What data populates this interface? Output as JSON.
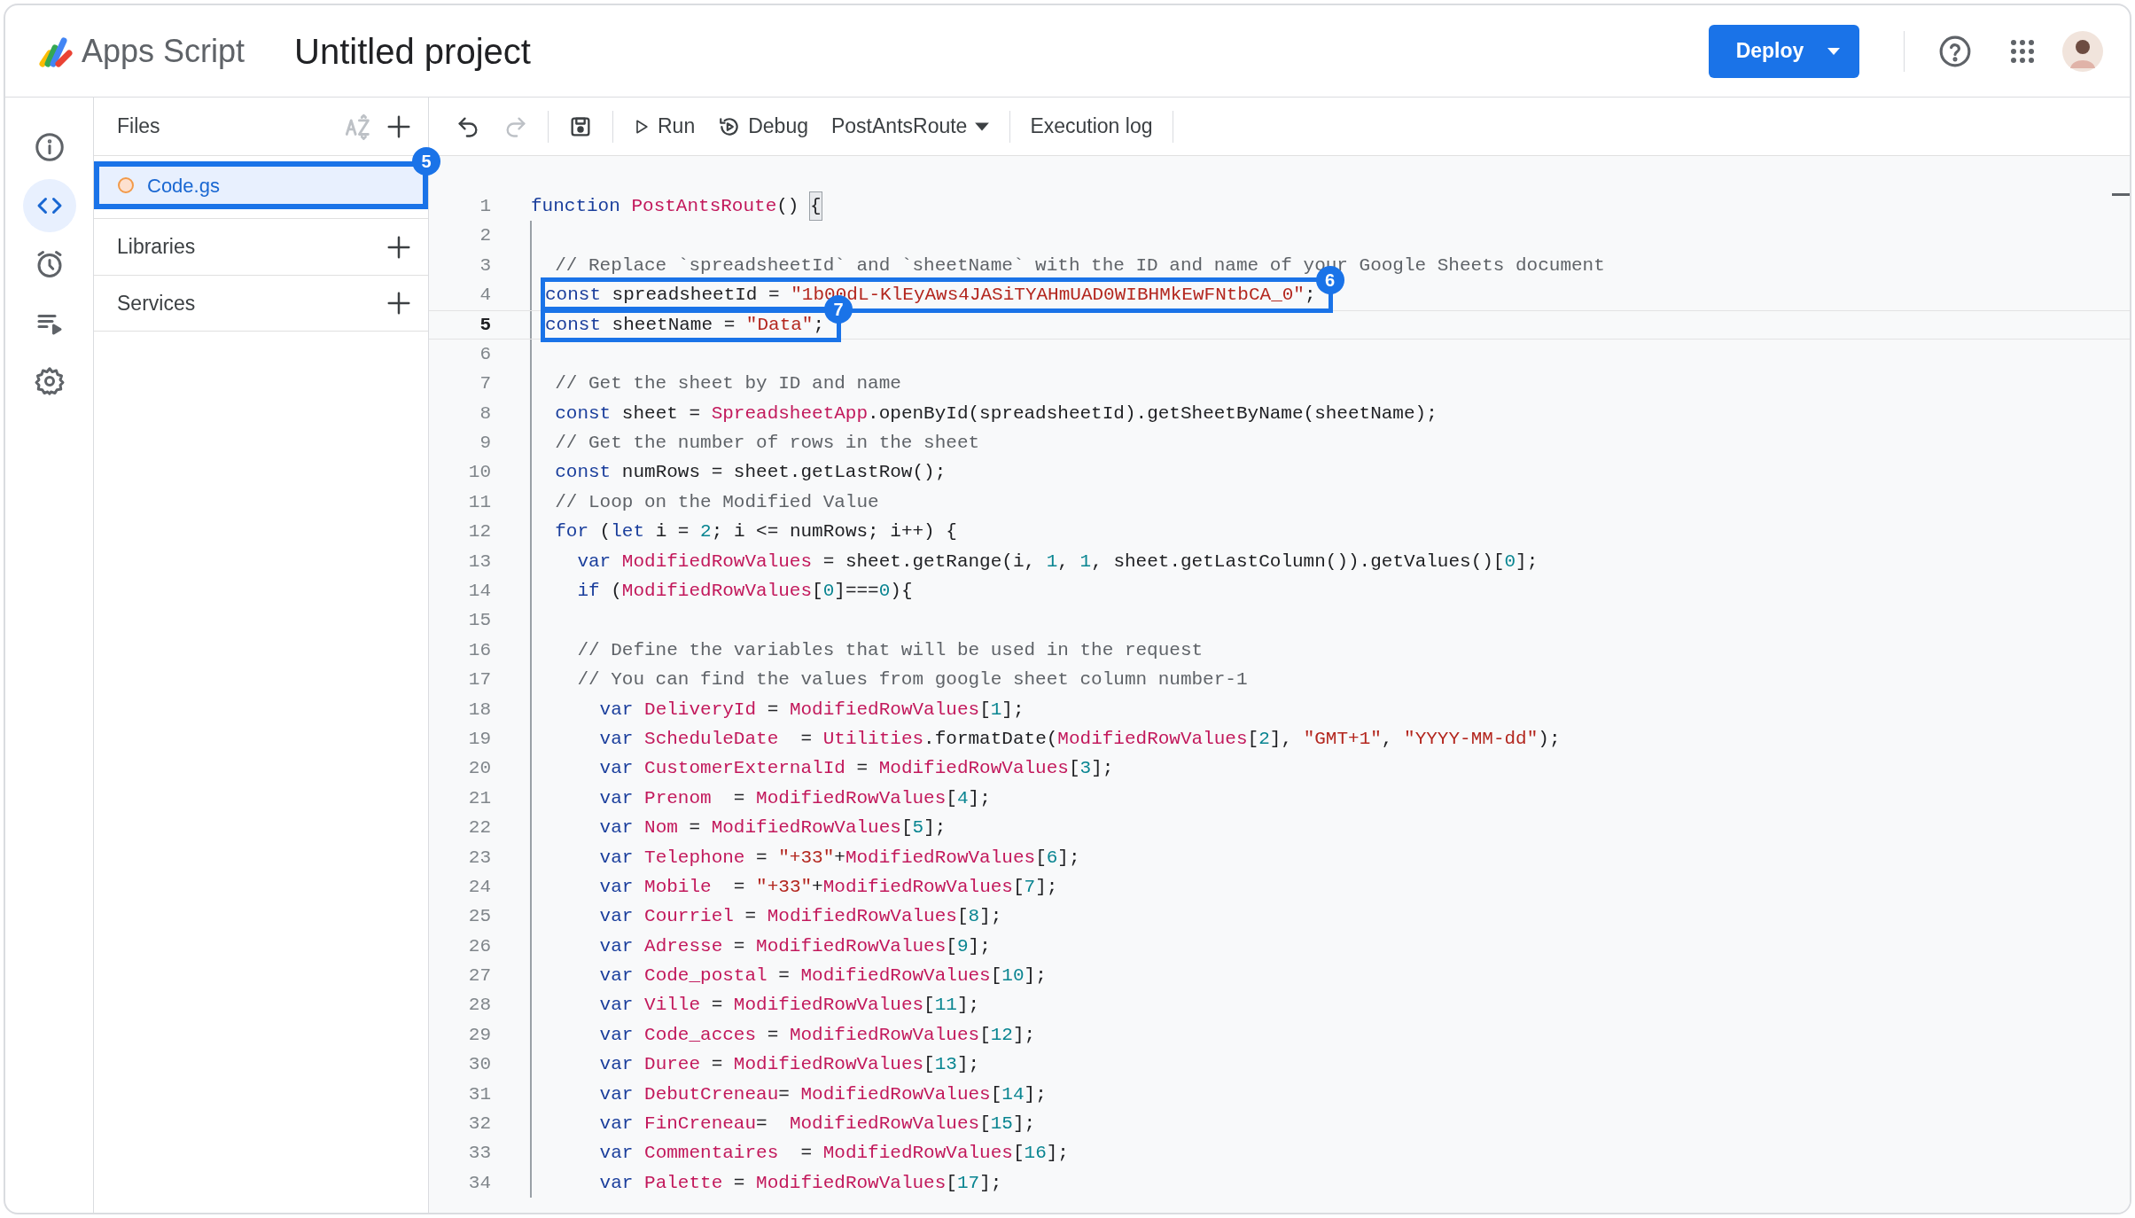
{
  "app": {
    "name": "Apps Script",
    "project_title": "Untitled project",
    "deploy_button": "Deploy"
  },
  "rail": [
    {
      "selected": false
    },
    {
      "selected": true
    },
    {
      "selected": false
    },
    {
      "selected": false
    },
    {
      "selected": false
    }
  ],
  "files_panel": {
    "title": "Files",
    "files": [
      {
        "name": "Code.gs",
        "selected": true,
        "callout": "5"
      }
    ],
    "sections": [
      {
        "title": "Libraries"
      },
      {
        "title": "Services"
      }
    ]
  },
  "toolbar": {
    "undo": {
      "disabled": false
    },
    "redo": {
      "disabled": true
    },
    "run": "Run",
    "debug": "Debug",
    "function_select": "PostAntsRoute",
    "execution_log": "Execution log"
  },
  "editor": {
    "lines": [
      {
        "number": "1",
        "current": false,
        "tokens": [
          {
            "kind": "keyword",
            "text": "function "
          },
          {
            "kind": "name",
            "text": "PostAntsRoute"
          },
          {
            "kind": "plain",
            "text": "() "
          },
          {
            "kind": "bracket",
            "text": "{"
          }
        ]
      },
      {
        "number": "2",
        "current": false
      },
      {
        "number": "3",
        "current": false,
        "tokens": [
          {
            "kind": "comment",
            "text": "  // Replace `spreadsheetId` and `sheetName` with the ID and name of your Google Sheets document"
          }
        ]
      },
      {
        "number": "4",
        "current": false,
        "callout": "6",
        "tokens": [
          {
            "kind": "keyword",
            "text": "const"
          },
          {
            "kind": "plain",
            "text": " spreadsheetId = "
          },
          {
            "kind": "string",
            "text": "\"1b00dL-KlEyAws4JASiTYAHmUAD0WIBHMkEwFNtbCA_0\""
          },
          {
            "kind": "plain",
            "text": ";"
          }
        ]
      },
      {
        "number": "5",
        "current": true,
        "callout": "7",
        "tokens": [
          {
            "kind": "keyword",
            "text": "const"
          },
          {
            "kind": "plain",
            "text": " sheetName = "
          },
          {
            "kind": "string",
            "text": "\"Data\""
          },
          {
            "kind": "plain",
            "text": ";"
          }
        ]
      },
      {
        "number": "6",
        "current": false
      },
      {
        "number": "7",
        "current": false,
        "tokens": [
          {
            "kind": "comment",
            "text": "  // Get the sheet by ID and name"
          }
        ]
      },
      {
        "number": "8",
        "current": false,
        "tokens": [
          {
            "kind": "keyword",
            "text": "  const"
          },
          {
            "kind": "plain",
            "text": " sheet = "
          },
          {
            "kind": "name",
            "text": "SpreadsheetApp"
          },
          {
            "kind": "plain",
            "text": ".openById(spreadsheetId).getSheetByName(sheetName);"
          }
        ]
      },
      {
        "number": "9",
        "current": false,
        "tokens": [
          {
            "kind": "comment",
            "text": "  // Get the number of rows in the sheet"
          }
        ]
      },
      {
        "number": "10",
        "current": false,
        "tokens": [
          {
            "kind": "keyword",
            "text": "  const"
          },
          {
            "kind": "plain",
            "text": " numRows = sheet.getLastRow();"
          }
        ]
      },
      {
        "number": "11",
        "current": false,
        "tokens": [
          {
            "kind": "comment",
            "text": "  // Loop on the Modified Value"
          }
        ]
      },
      {
        "number": "12",
        "current": false,
        "tokens": [
          {
            "kind": "keyword",
            "text": "  for"
          },
          {
            "kind": "plain",
            "text": " ("
          },
          {
            "kind": "keyword",
            "text": "let"
          },
          {
            "kind": "plain",
            "text": " i = "
          },
          {
            "kind": "number",
            "text": "2"
          },
          {
            "kind": "plain",
            "text": "; i <= numRows; i++) {"
          }
        ]
      },
      {
        "number": "13",
        "current": false,
        "tokens": [
          {
            "kind": "keyword",
            "text": "    var "
          },
          {
            "kind": "name",
            "text": "ModifiedRowValues"
          },
          {
            "kind": "plain",
            "text": " = sheet.getRange(i, "
          },
          {
            "kind": "number",
            "text": "1"
          },
          {
            "kind": "plain",
            "text": ", "
          },
          {
            "kind": "number",
            "text": "1"
          },
          {
            "kind": "plain",
            "text": ", sheet.getLastColumn()).getValues()["
          },
          {
            "kind": "number",
            "text": "0"
          },
          {
            "kind": "plain",
            "text": "];"
          }
        ]
      },
      {
        "number": "14",
        "current": false,
        "tokens": [
          {
            "kind": "keyword",
            "text": "    if"
          },
          {
            "kind": "plain",
            "text": " ("
          },
          {
            "kind": "name",
            "text": "ModifiedRowValues"
          },
          {
            "kind": "plain",
            "text": "["
          },
          {
            "kind": "number",
            "text": "0"
          },
          {
            "kind": "plain",
            "text": "]==="
          },
          {
            "kind": "number",
            "text": "0"
          },
          {
            "kind": "plain",
            "text": "){"
          }
        ]
      },
      {
        "number": "15",
        "current": false
      },
      {
        "number": "16",
        "current": false,
        "tokens": [
          {
            "kind": "comment",
            "text": "    // Define the variables that will be used in the request"
          }
        ]
      },
      {
        "number": "17",
        "current": false,
        "tokens": [
          {
            "kind": "comment",
            "text": "    // You can find the values from google sheet column number-1"
          }
        ]
      },
      {
        "number": "18",
        "current": false,
        "tokens": [
          {
            "kind": "keyword",
            "text": "      var "
          },
          {
            "kind": "name",
            "text": "DeliveryId"
          },
          {
            "kind": "plain",
            "text": " = "
          },
          {
            "kind": "name",
            "text": "ModifiedRowValues"
          },
          {
            "kind": "plain",
            "text": "["
          },
          {
            "kind": "number",
            "text": "1"
          },
          {
            "kind": "plain",
            "text": "];"
          }
        ]
      },
      {
        "number": "19",
        "current": false,
        "tokens": [
          {
            "kind": "keyword",
            "text": "      var "
          },
          {
            "kind": "name",
            "text": "ScheduleDate"
          },
          {
            "kind": "plain",
            "text": "  = "
          },
          {
            "kind": "name",
            "text": "Utilities"
          },
          {
            "kind": "plain",
            "text": ".formatDate("
          },
          {
            "kind": "name",
            "text": "ModifiedRowValues"
          },
          {
            "kind": "plain",
            "text": "["
          },
          {
            "kind": "number",
            "text": "2"
          },
          {
            "kind": "plain",
            "text": "], "
          },
          {
            "kind": "string",
            "text": "\"GMT+1\""
          },
          {
            "kind": "plain",
            "text": ", "
          },
          {
            "kind": "string",
            "text": "\"YYYY-MM-dd\""
          },
          {
            "kind": "plain",
            "text": ");"
          }
        ]
      },
      {
        "number": "20",
        "current": false,
        "tokens": [
          {
            "kind": "keyword",
            "text": "      var "
          },
          {
            "kind": "name",
            "text": "CustomerExternalId"
          },
          {
            "kind": "plain",
            "text": " = "
          },
          {
            "kind": "name",
            "text": "ModifiedRowValues"
          },
          {
            "kind": "plain",
            "text": "["
          },
          {
            "kind": "number",
            "text": "3"
          },
          {
            "kind": "plain",
            "text": "];"
          }
        ]
      },
      {
        "number": "21",
        "current": false,
        "tokens": [
          {
            "kind": "keyword",
            "text": "      var "
          },
          {
            "kind": "name",
            "text": "Prenom"
          },
          {
            "kind": "plain",
            "text": "  = "
          },
          {
            "kind": "name",
            "text": "ModifiedRowValues"
          },
          {
            "kind": "plain",
            "text": "["
          },
          {
            "kind": "number",
            "text": "4"
          },
          {
            "kind": "plain",
            "text": "];"
          }
        ]
      },
      {
        "number": "22",
        "current": false,
        "tokens": [
          {
            "kind": "keyword",
            "text": "      var "
          },
          {
            "kind": "name",
            "text": "Nom"
          },
          {
            "kind": "plain",
            "text": " = "
          },
          {
            "kind": "name",
            "text": "ModifiedRowValues"
          },
          {
            "kind": "plain",
            "text": "["
          },
          {
            "kind": "number",
            "text": "5"
          },
          {
            "kind": "plain",
            "text": "];"
          }
        ]
      },
      {
        "number": "23",
        "current": false,
        "tokens": [
          {
            "kind": "keyword",
            "text": "      var "
          },
          {
            "kind": "name",
            "text": "Telephone"
          },
          {
            "kind": "plain",
            "text": " = "
          },
          {
            "kind": "string",
            "text": "\"+33\""
          },
          {
            "kind": "plain",
            "text": "+"
          },
          {
            "kind": "name",
            "text": "ModifiedRowValues"
          },
          {
            "kind": "plain",
            "text": "["
          },
          {
            "kind": "number",
            "text": "6"
          },
          {
            "kind": "plain",
            "text": "];"
          }
        ]
      },
      {
        "number": "24",
        "current": false,
        "tokens": [
          {
            "kind": "keyword",
            "text": "      var "
          },
          {
            "kind": "name",
            "text": "Mobile"
          },
          {
            "kind": "plain",
            "text": "  = "
          },
          {
            "kind": "string",
            "text": "\"+33\""
          },
          {
            "kind": "plain",
            "text": "+"
          },
          {
            "kind": "name",
            "text": "ModifiedRowValues"
          },
          {
            "kind": "plain",
            "text": "["
          },
          {
            "kind": "number",
            "text": "7"
          },
          {
            "kind": "plain",
            "text": "];"
          }
        ]
      },
      {
        "number": "25",
        "current": false,
        "tokens": [
          {
            "kind": "keyword",
            "text": "      var "
          },
          {
            "kind": "name",
            "text": "Courriel"
          },
          {
            "kind": "plain",
            "text": " = "
          },
          {
            "kind": "name",
            "text": "ModifiedRowValues"
          },
          {
            "kind": "plain",
            "text": "["
          },
          {
            "kind": "number",
            "text": "8"
          },
          {
            "kind": "plain",
            "text": "];"
          }
        ]
      },
      {
        "number": "26",
        "current": false,
        "tokens": [
          {
            "kind": "keyword",
            "text": "      var "
          },
          {
            "kind": "name",
            "text": "Adresse"
          },
          {
            "kind": "plain",
            "text": " = "
          },
          {
            "kind": "name",
            "text": "ModifiedRowValues"
          },
          {
            "kind": "plain",
            "text": "["
          },
          {
            "kind": "number",
            "text": "9"
          },
          {
            "kind": "plain",
            "text": "];"
          }
        ]
      },
      {
        "number": "27",
        "current": false,
        "tokens": [
          {
            "kind": "keyword",
            "text": "      var "
          },
          {
            "kind": "name",
            "text": "Code_postal"
          },
          {
            "kind": "plain",
            "text": " = "
          },
          {
            "kind": "name",
            "text": "ModifiedRowValues"
          },
          {
            "kind": "plain",
            "text": "["
          },
          {
            "kind": "number",
            "text": "10"
          },
          {
            "kind": "plain",
            "text": "];"
          }
        ]
      },
      {
        "number": "28",
        "current": false,
        "tokens": [
          {
            "kind": "keyword",
            "text": "      var "
          },
          {
            "kind": "name",
            "text": "Ville"
          },
          {
            "kind": "plain",
            "text": " = "
          },
          {
            "kind": "name",
            "text": "ModifiedRowValues"
          },
          {
            "kind": "plain",
            "text": "["
          },
          {
            "kind": "number",
            "text": "11"
          },
          {
            "kind": "plain",
            "text": "];"
          }
        ]
      },
      {
        "number": "29",
        "current": false,
        "tokens": [
          {
            "kind": "keyword",
            "text": "      var "
          },
          {
            "kind": "name",
            "text": "Code_acces"
          },
          {
            "kind": "plain",
            "text": " = "
          },
          {
            "kind": "name",
            "text": "ModifiedRowValues"
          },
          {
            "kind": "plain",
            "text": "["
          },
          {
            "kind": "number",
            "text": "12"
          },
          {
            "kind": "plain",
            "text": "];"
          }
        ]
      },
      {
        "number": "30",
        "current": false,
        "tokens": [
          {
            "kind": "keyword",
            "text": "      var "
          },
          {
            "kind": "name",
            "text": "Duree"
          },
          {
            "kind": "plain",
            "text": " = "
          },
          {
            "kind": "name",
            "text": "ModifiedRowValues"
          },
          {
            "kind": "plain",
            "text": "["
          },
          {
            "kind": "number",
            "text": "13"
          },
          {
            "kind": "plain",
            "text": "];"
          }
        ]
      },
      {
        "number": "31",
        "current": false,
        "tokens": [
          {
            "kind": "keyword",
            "text": "      var "
          },
          {
            "kind": "name",
            "text": "DebutCreneau"
          },
          {
            "kind": "plain",
            "text": "= "
          },
          {
            "kind": "name",
            "text": "ModifiedRowValues"
          },
          {
            "kind": "plain",
            "text": "["
          },
          {
            "kind": "number",
            "text": "14"
          },
          {
            "kind": "plain",
            "text": "];"
          }
        ]
      },
      {
        "number": "32",
        "current": false,
        "tokens": [
          {
            "kind": "keyword",
            "text": "      var "
          },
          {
            "kind": "name",
            "text": "FinCreneau"
          },
          {
            "kind": "plain",
            "text": "=  "
          },
          {
            "kind": "name",
            "text": "ModifiedRowValues"
          },
          {
            "kind": "plain",
            "text": "["
          },
          {
            "kind": "number",
            "text": "15"
          },
          {
            "kind": "plain",
            "text": "];"
          }
        ]
      },
      {
        "number": "33",
        "current": false,
        "tokens": [
          {
            "kind": "keyword",
            "text": "      var "
          },
          {
            "kind": "name",
            "text": "Commentaires"
          },
          {
            "kind": "plain",
            "text": "  = "
          },
          {
            "kind": "name",
            "text": "ModifiedRowValues"
          },
          {
            "kind": "plain",
            "text": "["
          },
          {
            "kind": "number",
            "text": "16"
          },
          {
            "kind": "plain",
            "text": "];"
          }
        ]
      },
      {
        "number": "34",
        "current": false,
        "tokens": [
          {
            "kind": "keyword",
            "text": "      var "
          },
          {
            "kind": "name",
            "text": "Palette"
          },
          {
            "kind": "plain",
            "text": " = "
          },
          {
            "kind": "name",
            "text": "ModifiedRowValues"
          },
          {
            "kind": "plain",
            "text": "["
          },
          {
            "kind": "number",
            "text": "17"
          },
          {
            "kind": "plain",
            "text": "];"
          }
        ]
      }
    ]
  }
}
